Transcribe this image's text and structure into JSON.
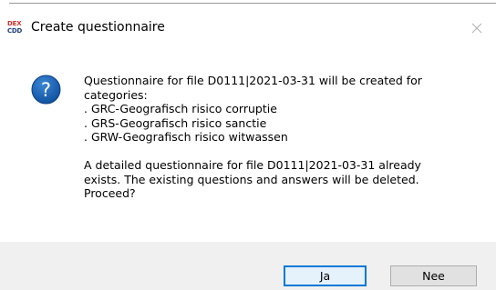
{
  "window": {
    "logo_line1": "DEX",
    "logo_line2": "CDD",
    "title": "Create questionnaire"
  },
  "icons": {
    "app": "dex-cdd-logo-icon",
    "close": "close-icon",
    "dialog": "question-icon"
  },
  "message": {
    "line1": "Questionnaire for file D0111|2021-03-31 will be created for",
    "line2": "categories:",
    "categories": [
      ". GRC-Geografisch risico corruptie",
      ". GRS-Geografisch risico sanctie",
      ". GRW-Geografisch risico witwassen"
    ],
    "detail_line1": "A detailed questionnaire for file D0111|2021-03-31 already",
    "detail_line2": "exists. The existing questions and answers will be deleted.",
    "detail_line3": "Proceed?"
  },
  "buttons": {
    "yes_label": "Ja",
    "no_label": "Nee"
  },
  "colors": {
    "accent": "#0078d7",
    "icon_blue": "#1a5fb4",
    "footer_bg": "#f0f0f0"
  }
}
